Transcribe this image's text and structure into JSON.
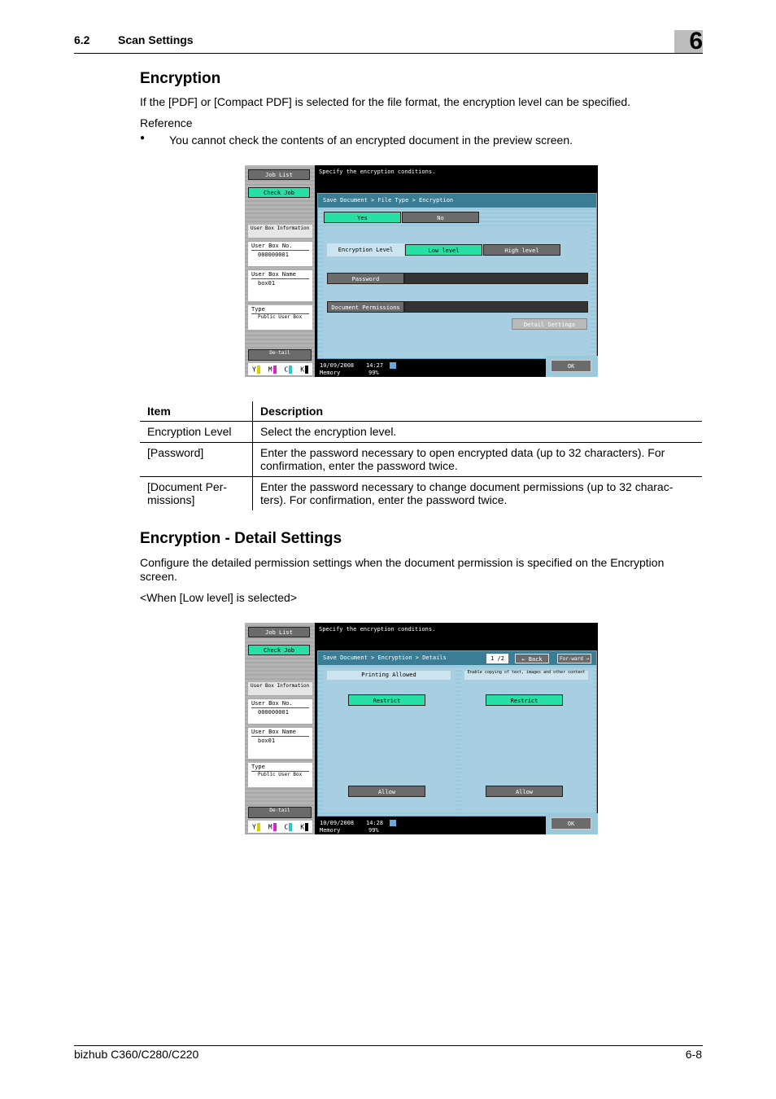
{
  "header": {
    "section_number": "6.2",
    "section_title": "Scan Settings",
    "chapter": "6"
  },
  "encryption": {
    "heading": "Encryption",
    "intro": "If the [PDF] or [Compact PDF] is selected for the file format, the encryption level can be specified.",
    "reference_label": "Reference",
    "bullet_symbol": "●",
    "bullet": "You cannot check the contents of an encrypted document in the preview screen."
  },
  "screen1": {
    "sidebar": {
      "job_list": "Job List",
      "check_job": "Check Job",
      "user_box_info": "User Box Information",
      "user_box_no_label": "User Box No.",
      "user_box_no": "000000001",
      "user_box_name_label": "User Box Name",
      "user_box_name": "box01",
      "type_label": "Type",
      "type_value": "Public User Box",
      "detail": "De-tail",
      "toner": [
        "Y",
        "M",
        "C",
        "K"
      ]
    },
    "message": "Specify the encryption conditions.",
    "breadcrumb": "Save Document > File Type > Encryption",
    "yes": "Yes",
    "no": "No",
    "encryption_level_label": "Encryption Level",
    "low_level": "Low level",
    "high_level": "High level",
    "password": "Password",
    "document_permissions": "Document Permissions",
    "detail_settings": "Detail Settings",
    "date": "10/09/2008",
    "time": "14:27",
    "memory_label": "Memory",
    "memory_value": "99%",
    "ok": "OK"
  },
  "table": {
    "headers": [
      "Item",
      "Description"
    ],
    "rows": [
      [
        "Encryption Level",
        "Select the encryption level."
      ],
      [
        "[Password]",
        "Enter the password necessary to open encrypted data (up to 32 characters). For confirmation, enter the password twice."
      ],
      [
        "[Document Per-missions]",
        "Enter the password necessary to change document permissions (up to 32 charac-ters). For confirmation, enter the password twice."
      ]
    ]
  },
  "detail_settings": {
    "heading": "Encryption - Detail Settings",
    "intro": "Configure the detailed permission settings when the document permission is specified on the Encryption screen.",
    "condition": "<When [Low level] is selected>"
  },
  "screen2": {
    "sidebar": {
      "job_list": "Job List",
      "check_job": "Check Job",
      "user_box_info": "User Box Information",
      "user_box_no_label": "User Box No.",
      "user_box_no": "000000001",
      "user_box_name_label": "User Box Name",
      "user_box_name": "box01",
      "type_label": "Type",
      "type_value": "Public User Box",
      "detail": "De-tail",
      "toner": [
        "Y",
        "M",
        "C",
        "K"
      ]
    },
    "message": "Specify the encryption conditions.",
    "breadcrumb": "Save Document > Encryption > Details",
    "page": "1 /2",
    "back": "← Back",
    "forward": "For-ward →",
    "col1_label": "Printing Allowed",
    "col2_label": "Enable copying of text, images and other content",
    "restrict": "Restrict",
    "allow": "Allow",
    "date": "10/09/2008",
    "time": "14:28",
    "memory_label": "Memory",
    "memory_value": "99%",
    "ok": "OK"
  },
  "footer": {
    "product": "bizhub C360/C280/C220",
    "page": "6-8"
  }
}
